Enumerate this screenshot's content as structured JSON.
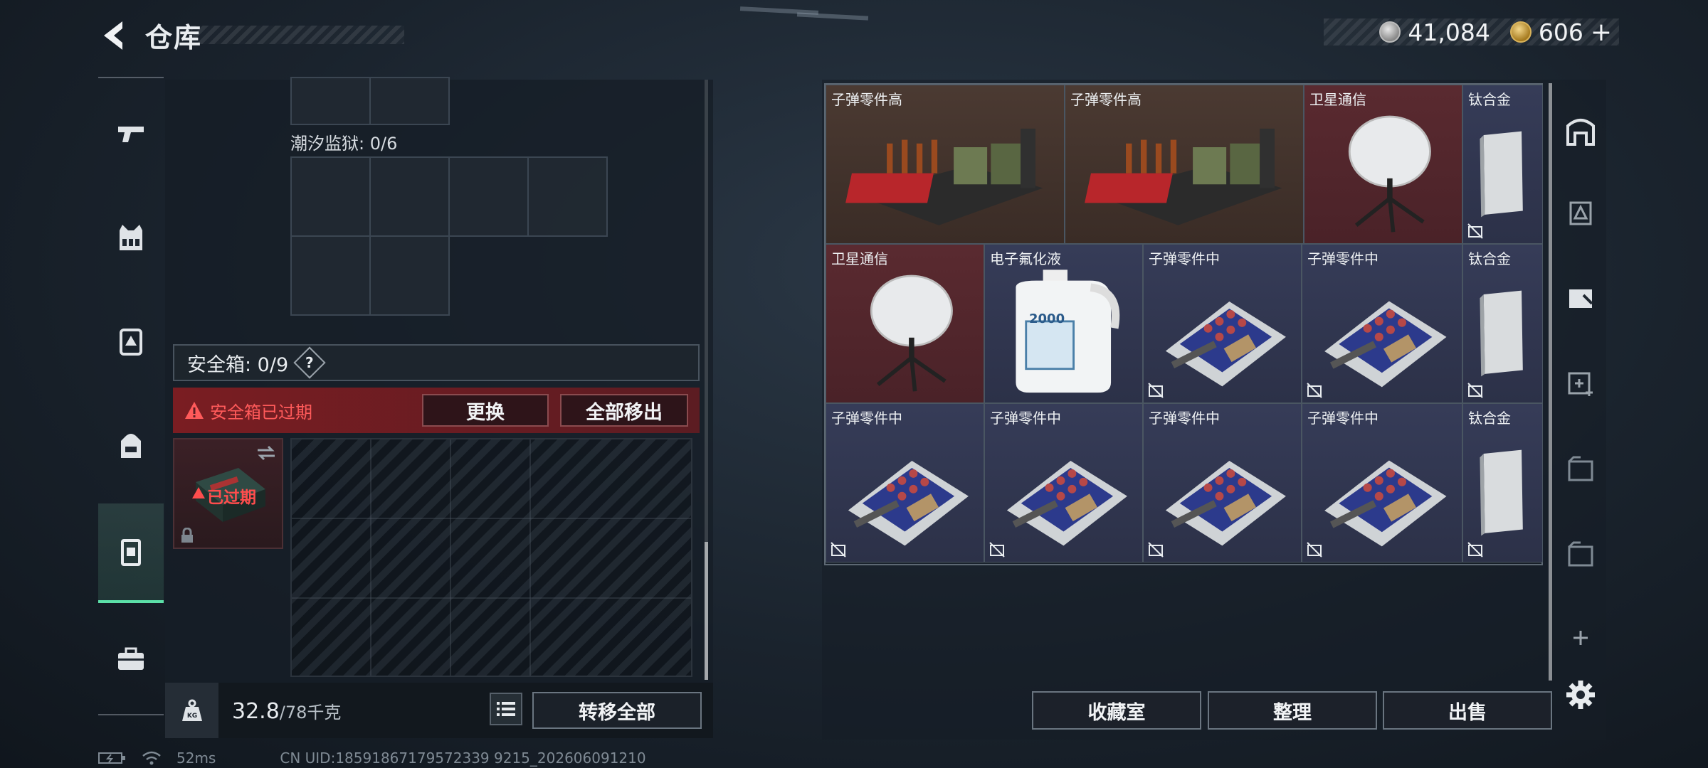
{
  "header": {
    "title": "仓库",
    "currency": [
      {
        "icon": "silver-coin-icon",
        "value": "41,084"
      },
      {
        "icon": "gold-coin-icon",
        "value": "606"
      }
    ],
    "currency_add": "+"
  },
  "left_rail": [
    "pistol-icon",
    "vest-icon",
    "backpack-armor-icon",
    "backpack-icon",
    "safe-case-icon",
    "toolbox-icon"
  ],
  "left_panel": {
    "tide_prison_label": "潮汐监狱: 0/6",
    "safe_box_label": "安全箱: 0/9",
    "safe_box_help": "?",
    "expired_warning": "安全箱已过期",
    "replace_button": "更换",
    "move_all_out_button": "全部移出",
    "case_status": "已过期"
  },
  "weight": {
    "current": "32.8",
    "max": "/78千克"
  },
  "transfer_all_button": "转移全部",
  "stash_items": [
    {
      "name": "子弹零件高",
      "bg": "brown",
      "art": "ammo-high"
    },
    {
      "name": "子弹零件高",
      "bg": "brown",
      "art": "ammo-high"
    },
    {
      "name": "卫星通信",
      "bg": "red",
      "art": "satellite"
    },
    {
      "name": "钛合金",
      "bg": "blue",
      "art": "titanium",
      "locked": true
    },
    {
      "name": "卫星通信",
      "bg": "red",
      "art": "satellite"
    },
    {
      "name": "电子氟化液",
      "bg": "blue",
      "art": "jug",
      "jug_label": "2000"
    },
    {
      "name": "子弹零件中",
      "bg": "blue",
      "art": "ammo-mid",
      "locked": true
    },
    {
      "name": "子弹零件中",
      "bg": "blue",
      "art": "ammo-mid",
      "locked": true
    },
    {
      "name": "钛合金",
      "bg": "blue",
      "art": "titanium",
      "locked": true
    },
    {
      "name": "子弹零件中",
      "bg": "blue",
      "art": "ammo-mid",
      "locked": true
    },
    {
      "name": "子弹零件中",
      "bg": "blue",
      "art": "ammo-mid",
      "locked": true
    },
    {
      "name": "子弹零件中",
      "bg": "blue",
      "art": "ammo-mid",
      "locked": true
    },
    {
      "name": "子弹零件中",
      "bg": "blue",
      "art": "ammo-mid",
      "locked": true
    },
    {
      "name": "钛合金",
      "bg": "blue",
      "art": "titanium",
      "locked": true
    }
  ],
  "right_rail": [
    "stash-main-icon",
    "stash-page-2-icon",
    "stash-page-3-icon",
    "stash-page-add-icon",
    "stash-page-4-icon",
    "stash-page-1-icon",
    "add-icon",
    "settings-icon"
  ],
  "bottom_buttons": {
    "collection": "收藏室",
    "sort": "整理",
    "sell": "出售"
  },
  "status": {
    "ping": "52ms",
    "uid": "CN UID:18591867179572339 9215_202606091210"
  },
  "colors": {
    "accent": "#5ce0a8",
    "warning": "#ff5a5a",
    "warning_bg": "#7a1d22"
  }
}
